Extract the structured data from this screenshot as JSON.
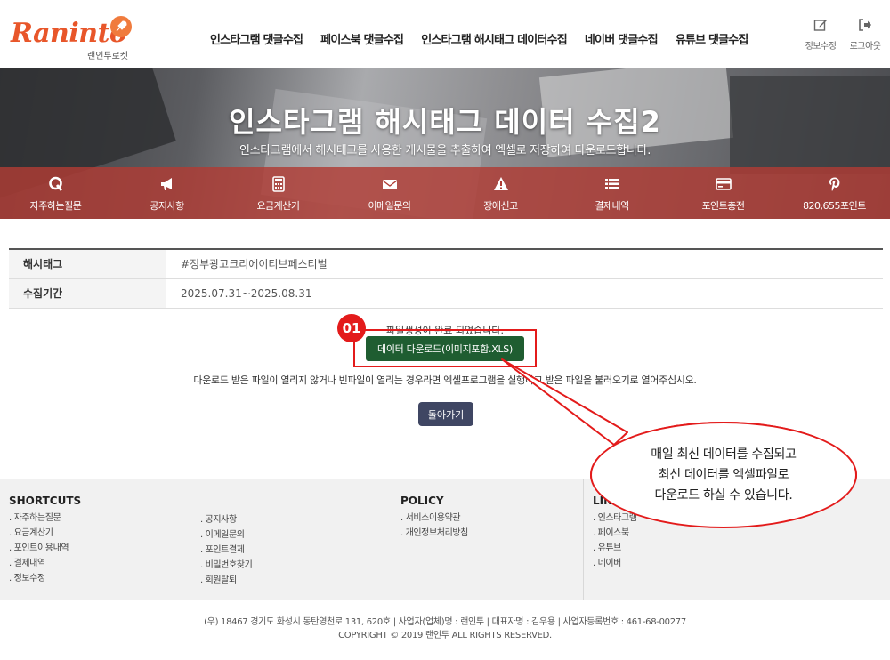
{
  "brand": {
    "logo_main": "Raninto",
    "logo_sub": "랜인투로켓"
  },
  "gnb": [
    "인스타그램 댓글수집",
    "페이스북 댓글수집",
    "인스타그램 해시태그 데이터수집",
    "네이버 댓글수집",
    "유튜브 댓글수집"
  ],
  "util": {
    "edit_label": "정보수정",
    "logout_label": "로그아웃"
  },
  "hero": {
    "title": "인스타그램 해시태그 데이터 수집2",
    "subtitle": "인스타그램에서 해시태그를 사용한 게시물을 추출하여 엑셀로 저장하여 다운로드합니다."
  },
  "quick": [
    {
      "label": "자주하는질문",
      "icon": "q-icon"
    },
    {
      "label": "공지사항",
      "icon": "megaphone-icon"
    },
    {
      "label": "요금계산기",
      "icon": "calculator-icon"
    },
    {
      "label": "이메일문의",
      "icon": "envelope-icon"
    },
    {
      "label": "장애신고",
      "icon": "warning-icon"
    },
    {
      "label": "결제내역",
      "icon": "list-icon"
    },
    {
      "label": "포인트충전",
      "icon": "credit-card-icon"
    },
    {
      "label": "820,655포인트",
      "icon": "pinterest-icon"
    }
  ],
  "info": {
    "hashtag_label": "해시태그",
    "hashtag_value": "#정부광고크리에이티브페스티벌",
    "period_label": "수집기간",
    "period_value": "2025.07.31~2025.08.31"
  },
  "result": {
    "done_message": "파일생성이 완료 되었습니다.",
    "download_label": "데이터 다운로드(이미지포함.XLS)",
    "badge": "01",
    "notice": "다운로드 받은 파일이 열리지 않거나 빈파일이 열리는 경우라면 엑셀프로그램을 실행하고 받은 파일을 불러오기로 열어주십시오.",
    "back_label": "돌아가기"
  },
  "callout": {
    "line1": "매일 최신 데이터를 수집되고",
    "line2": "최신 데이터를 엑셀파일로",
    "line3": "다운로드 하실 수 있습니다."
  },
  "footer": {
    "shortcuts_title": "SHORTCUTS",
    "shortcuts_col1": [
      "자주하는질문",
      "요금계산기",
      "포인트이용내역",
      "결제내역",
      "정보수정"
    ],
    "shortcuts_col2": [
      "공지사항",
      "이메일문의",
      "포인트결제",
      "비밀번호찾기",
      "회원탈퇴"
    ],
    "policy_title": "POLICY",
    "policy_items": [
      "서비스이용약관",
      "개인정보처리방침"
    ],
    "links_title": "LINKS",
    "links_items": [
      "인스타그램",
      "페이스북",
      "유튜브",
      "네이버"
    ],
    "address": "(우) 18467 경기도 화성시 동탄영천로 131, 620호 | 사업자(업체)명 : 랜인투 | 대표자명 : 김우용 | 사업자등록번호 : 461-68-00277",
    "copyright": "COPYRIGHT © 2019 랜인투 ALL RIGHTS RESERVED."
  },
  "colors": {
    "accent_orange": "#e8562a",
    "quick_bar": "#b03c34",
    "download_green": "#1f5d31",
    "back_navy": "#3f4663",
    "highlight_red": "#e31b1b"
  }
}
